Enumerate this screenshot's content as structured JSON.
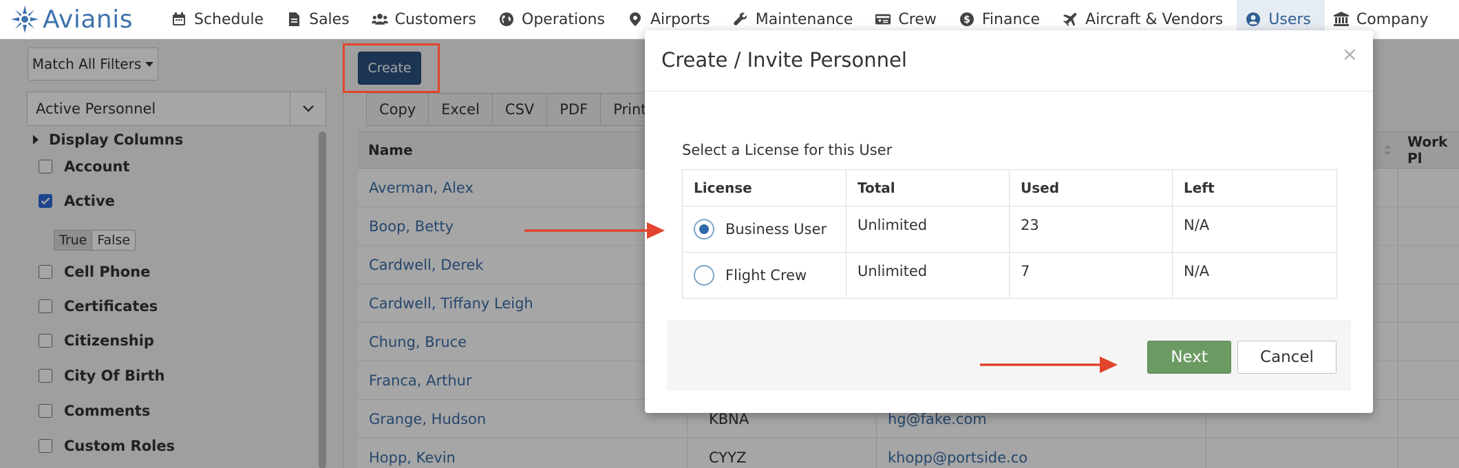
{
  "brand": {
    "name": "Avianis"
  },
  "nav": [
    {
      "label": "Schedule",
      "icon": "calendar-icon"
    },
    {
      "label": "Sales",
      "icon": "document-icon"
    },
    {
      "label": "Customers",
      "icon": "users-icon"
    },
    {
      "label": "Operations",
      "icon": "globe-icon"
    },
    {
      "label": "Airports",
      "icon": "map-pin-icon"
    },
    {
      "label": "Maintenance",
      "icon": "wrench-icon"
    },
    {
      "label": "Crew",
      "icon": "id-card-icon"
    },
    {
      "label": "Finance",
      "icon": "dollar-icon"
    },
    {
      "label": "Aircraft & Vendors",
      "icon": "plane-icon"
    },
    {
      "label": "Users",
      "icon": "user-circle-icon",
      "active": true
    },
    {
      "label": "Company",
      "icon": "building-icon"
    }
  ],
  "left_panel": {
    "match_filters_label": "Match All Filters",
    "view_select_value": "Active Personnel",
    "display_columns_label": "Display Columns",
    "filters": [
      {
        "label": "Account",
        "checked": false
      },
      {
        "label": "Active",
        "checked": true
      },
      {
        "label": "Cell Phone",
        "checked": false
      },
      {
        "label": "Certificates",
        "checked": false
      },
      {
        "label": "Citizenship",
        "checked": false
      },
      {
        "label": "City Of Birth",
        "checked": false
      },
      {
        "label": "Comments",
        "checked": false
      },
      {
        "label": "Custom Roles",
        "checked": false
      }
    ],
    "active_toggle": {
      "true_label": "True",
      "false_label": "False"
    }
  },
  "main": {
    "create_label": "Create",
    "export_buttons": [
      "Copy",
      "Excel",
      "CSV",
      "PDF",
      "Print"
    ],
    "columns": {
      "name": "Name",
      "work_phone": "Work Pl"
    },
    "rows": [
      {
        "name": "Averman, Alex",
        "base": "",
        "email": ""
      },
      {
        "name": "Boop, Betty",
        "base": "",
        "email": ""
      },
      {
        "name": "Cardwell, Derek",
        "base": "",
        "email": ""
      },
      {
        "name": "Cardwell, Tiffany Leigh",
        "base": "",
        "email": ""
      },
      {
        "name": "Chung, Bruce",
        "base": "",
        "email": ""
      },
      {
        "name": "Franca, Arthur",
        "base": "",
        "email": ""
      },
      {
        "name": "Grange, Hudson",
        "base": "KBNA",
        "email": "hg@fake.com"
      },
      {
        "name": "Hopp, Kevin",
        "base": "CYYZ",
        "email": "khopp@portside.co"
      }
    ]
  },
  "modal": {
    "title": "Create / Invite Personnel",
    "close_glyph": "×",
    "license_prompt": "Select a License for this User",
    "headers": {
      "license": "License",
      "total": "Total",
      "used": "Used",
      "left": "Left"
    },
    "licenses": [
      {
        "name": "Business User",
        "total": "Unlimited",
        "used": "23",
        "left": "N/A",
        "selected": true
      },
      {
        "name": "Flight Crew",
        "total": "Unlimited",
        "used": "7",
        "left": "N/A",
        "selected": false
      }
    ],
    "next_label": "Next",
    "cancel_label": "Cancel"
  },
  "colors": {
    "brand": "#3d72ad",
    "annotation": "#e2442d",
    "next_button": "#6c9a63",
    "create_button": "#2c5282"
  }
}
